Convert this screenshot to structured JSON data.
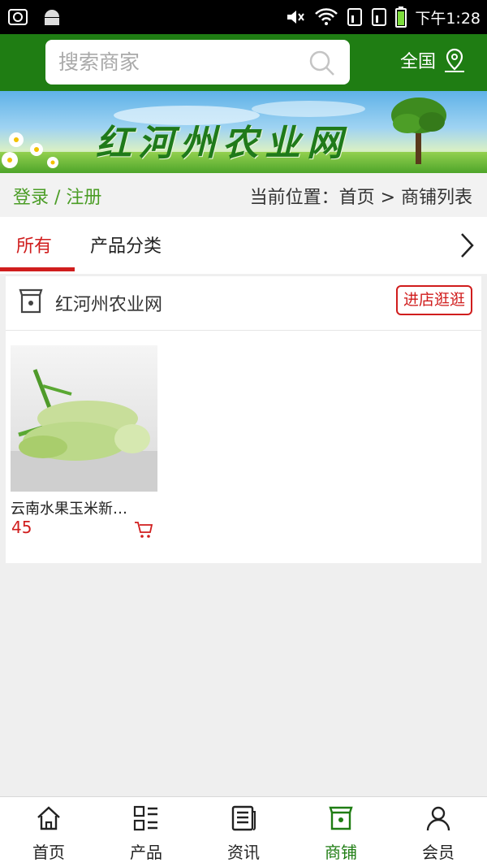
{
  "status_bar": {
    "time": "下午1:28"
  },
  "header": {
    "search_placeholder": "搜索商家",
    "region_label": "全国"
  },
  "banner": {
    "title": "红河州农业网"
  },
  "breadcrumb": {
    "login_label": "登录 / 注册",
    "location_text": "当前位置：首页 > 商铺列表"
  },
  "tabs": [
    {
      "label": "所有",
      "active": true
    },
    {
      "label": "产品分类",
      "active": false
    }
  ],
  "store": {
    "name": "红河州农业网",
    "visit_label": "进店逛逛",
    "products": [
      {
        "name": "云南水果玉米新…",
        "price": "45"
      }
    ]
  },
  "bottom_nav": [
    {
      "label": "首页",
      "icon": "home-icon",
      "active": false
    },
    {
      "label": "产品",
      "icon": "grid-list-icon",
      "active": false
    },
    {
      "label": "资讯",
      "icon": "news-icon",
      "active": false
    },
    {
      "label": "商铺",
      "icon": "shop-icon",
      "active": true
    },
    {
      "label": "会员",
      "icon": "user-icon",
      "active": false
    }
  ],
  "colors": {
    "brand_green": "#1f7d13",
    "accent_red": "#d01d1d",
    "link_green": "#4b9d26"
  }
}
